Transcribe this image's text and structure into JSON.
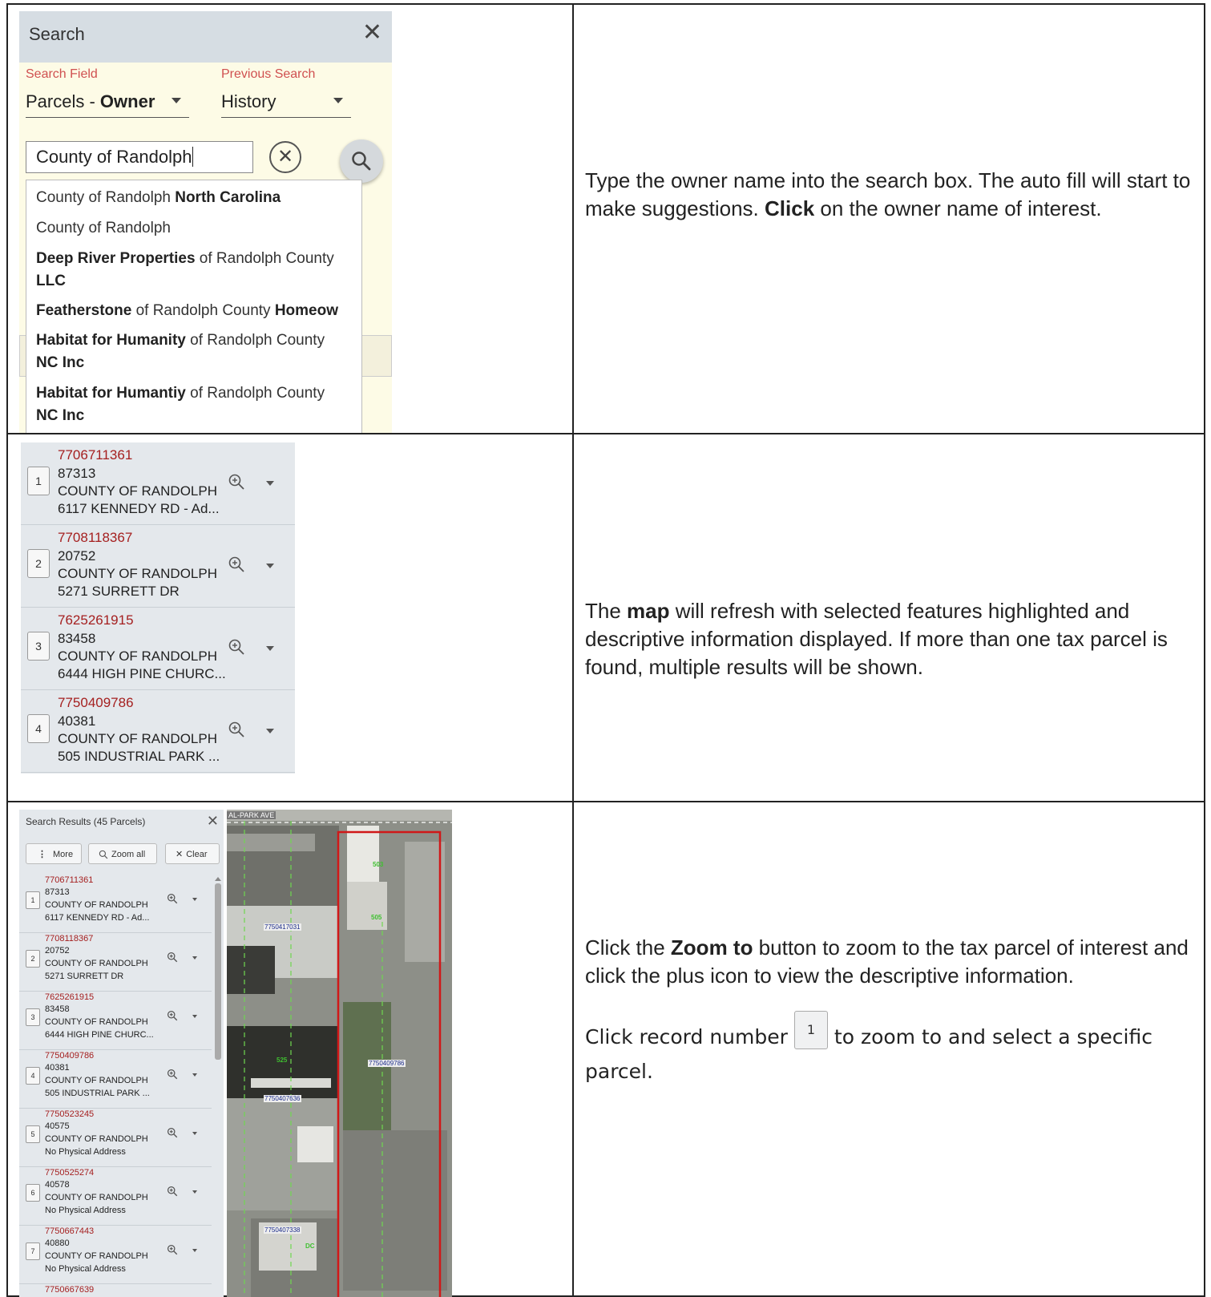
{
  "panel1": {
    "title": "Search",
    "search_field_label": "Search Field",
    "search_field_value_a": "Parcels - ",
    "search_field_value_b": "Owner",
    "previous_search_label": "Previous Search",
    "previous_search_value": "History",
    "input_value": "County of Randolph",
    "suggestions": [
      {
        "a": "County of Randolph ",
        "b": "North Carolina"
      },
      {
        "a": "County of Randolph",
        "b": ""
      },
      {
        "a": "Deep River Properties",
        "b": " of Randolph County",
        "c": "LLC"
      },
      {
        "a": "Featherstone",
        "b": " of Randolph County ",
        "c": "Homeow"
      },
      {
        "a": "Habitat for Humanity",
        "b": " of Randolph County",
        "c": "NC Inc"
      },
      {
        "a": "Habitat for Humantiy",
        "b": " of Randolph County",
        "c": "NC Inc"
      }
    ]
  },
  "desc1": {
    "t1": "Type the owner name into the search box. The auto fill will start to make suggestions. ",
    "b1": "Click",
    "t2": " on the owner name of interest."
  },
  "panel2": {
    "rows": [
      {
        "n": "1",
        "pin": "7706711361",
        "id": "87313",
        "owner": "COUNTY OF RANDOLPH",
        "addr": "6117 KENNEDY RD - Ad..."
      },
      {
        "n": "2",
        "pin": "7708118367",
        "id": "20752",
        "owner": "COUNTY OF RANDOLPH",
        "addr": "5271 SURRETT DR"
      },
      {
        "n": "3",
        "pin": "7625261915",
        "id": "83458",
        "owner": "COUNTY OF RANDOLPH",
        "addr": "6444 HIGH PINE CHURC..."
      },
      {
        "n": "4",
        "pin": "7750409786",
        "id": "40381",
        "owner": "COUNTY OF RANDOLPH",
        "addr": "505 INDUSTRIAL PARK ..."
      }
    ]
  },
  "desc2": {
    "t1": "The ",
    "b1": "map",
    "t2": " will refresh with selected features highlighted and descriptive information displayed. If more than one tax parcel is found, multiple results will be shown."
  },
  "panel3": {
    "title": "Search Results (45 Parcels)",
    "btn_more": "More",
    "btn_zoom_all": "Zoom all",
    "btn_clear": "Clear",
    "rows": [
      {
        "n": "1",
        "pin": "7706711361",
        "id": "87313",
        "owner": "COUNTY OF RANDOLPH",
        "addr": "6117 KENNEDY RD - Ad..."
      },
      {
        "n": "2",
        "pin": "7708118367",
        "id": "20752",
        "owner": "COUNTY OF RANDOLPH",
        "addr": "5271 SURRETT DR"
      },
      {
        "n": "3",
        "pin": "7625261915",
        "id": "83458",
        "owner": "COUNTY OF RANDOLPH",
        "addr": "6444 HIGH PINE CHURC..."
      },
      {
        "n": "4",
        "pin": "7750409786",
        "id": "40381",
        "owner": "COUNTY OF RANDOLPH",
        "addr": "505 INDUSTRIAL PARK ..."
      },
      {
        "n": "5",
        "pin": "7750523245",
        "id": "40575",
        "owner": "COUNTY OF RANDOLPH",
        "addr": "No Physical Address"
      },
      {
        "n": "6",
        "pin": "7750525274",
        "id": "40578",
        "owner": "COUNTY OF RANDOLPH",
        "addr": "No Physical Address"
      },
      {
        "n": "7",
        "pin": "7750667443",
        "id": "40880",
        "owner": "COUNTY OF RANDOLPH",
        "addr": "No Physical Address"
      }
    ],
    "last_pin": "7750667639"
  },
  "map": {
    "street": "AL-PARK AVE",
    "labels": [
      "7750417031",
      "503",
      "505",
      "525",
      "7750409786",
      "7750407636",
      "7750407338",
      "DC"
    ]
  },
  "desc3": {
    "t1": "Click the ",
    "b1": "Zoom to",
    "t2": " button to zoom to the tax parcel of interest and click the plus icon to view the descriptive information.",
    "t3": "Click record number",
    "rec": "1",
    "t4": "to zoom to and select a specific parcel."
  }
}
